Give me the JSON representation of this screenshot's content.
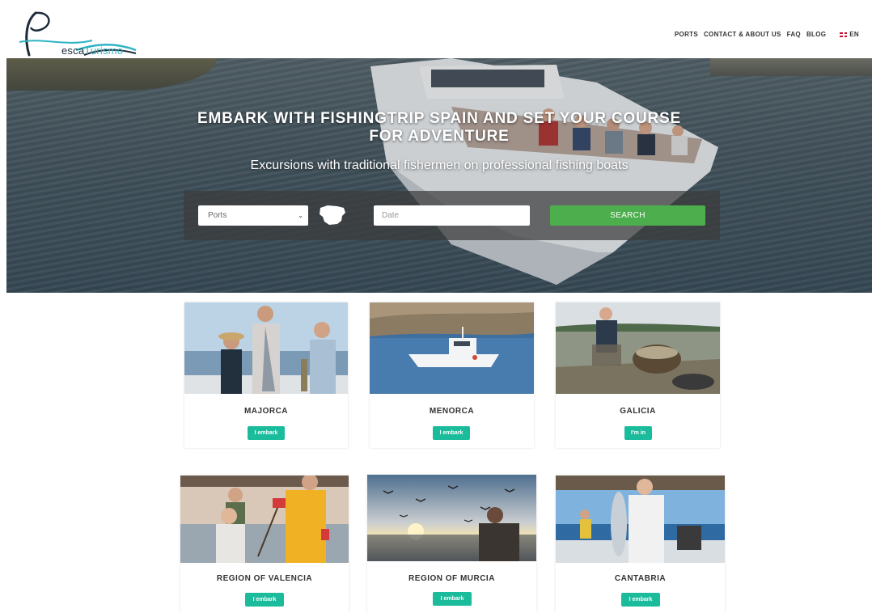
{
  "header": {
    "logo_part1": "esca",
    "logo_part2": "Turismo",
    "nav": [
      "PORTS",
      "CONTACT & ABOUT US",
      "FAQ",
      "BLOG"
    ],
    "language": "EN"
  },
  "hero": {
    "title_line1": "EMBARK WITH FISHINGTRIP SPAIN AND SET YOUR COURSE",
    "title_line2": "FOR ADVENTURE",
    "subtitle": "Excursions with traditional fishermen on professional fishing boats",
    "search": {
      "ports_value": "Ports",
      "date_placeholder": "Date",
      "search_label": "SEARCH"
    }
  },
  "cards": [
    {
      "name": "MAJORCA",
      "button": "I embark"
    },
    {
      "name": "MENORCA",
      "button": "I embark"
    },
    {
      "name": "GALICIA",
      "button": "I'm in"
    },
    {
      "name": "REGION OF VALENCIA",
      "button": "I embark"
    },
    {
      "name": "REGION OF MURCIA",
      "button": "I embark"
    },
    {
      "name": "CANTABRIA",
      "button": "I embark"
    }
  ],
  "colors": {
    "search_button": "#4cae4c",
    "card_button": "#1abc9c",
    "logo_accent": "#2eb4c4"
  }
}
